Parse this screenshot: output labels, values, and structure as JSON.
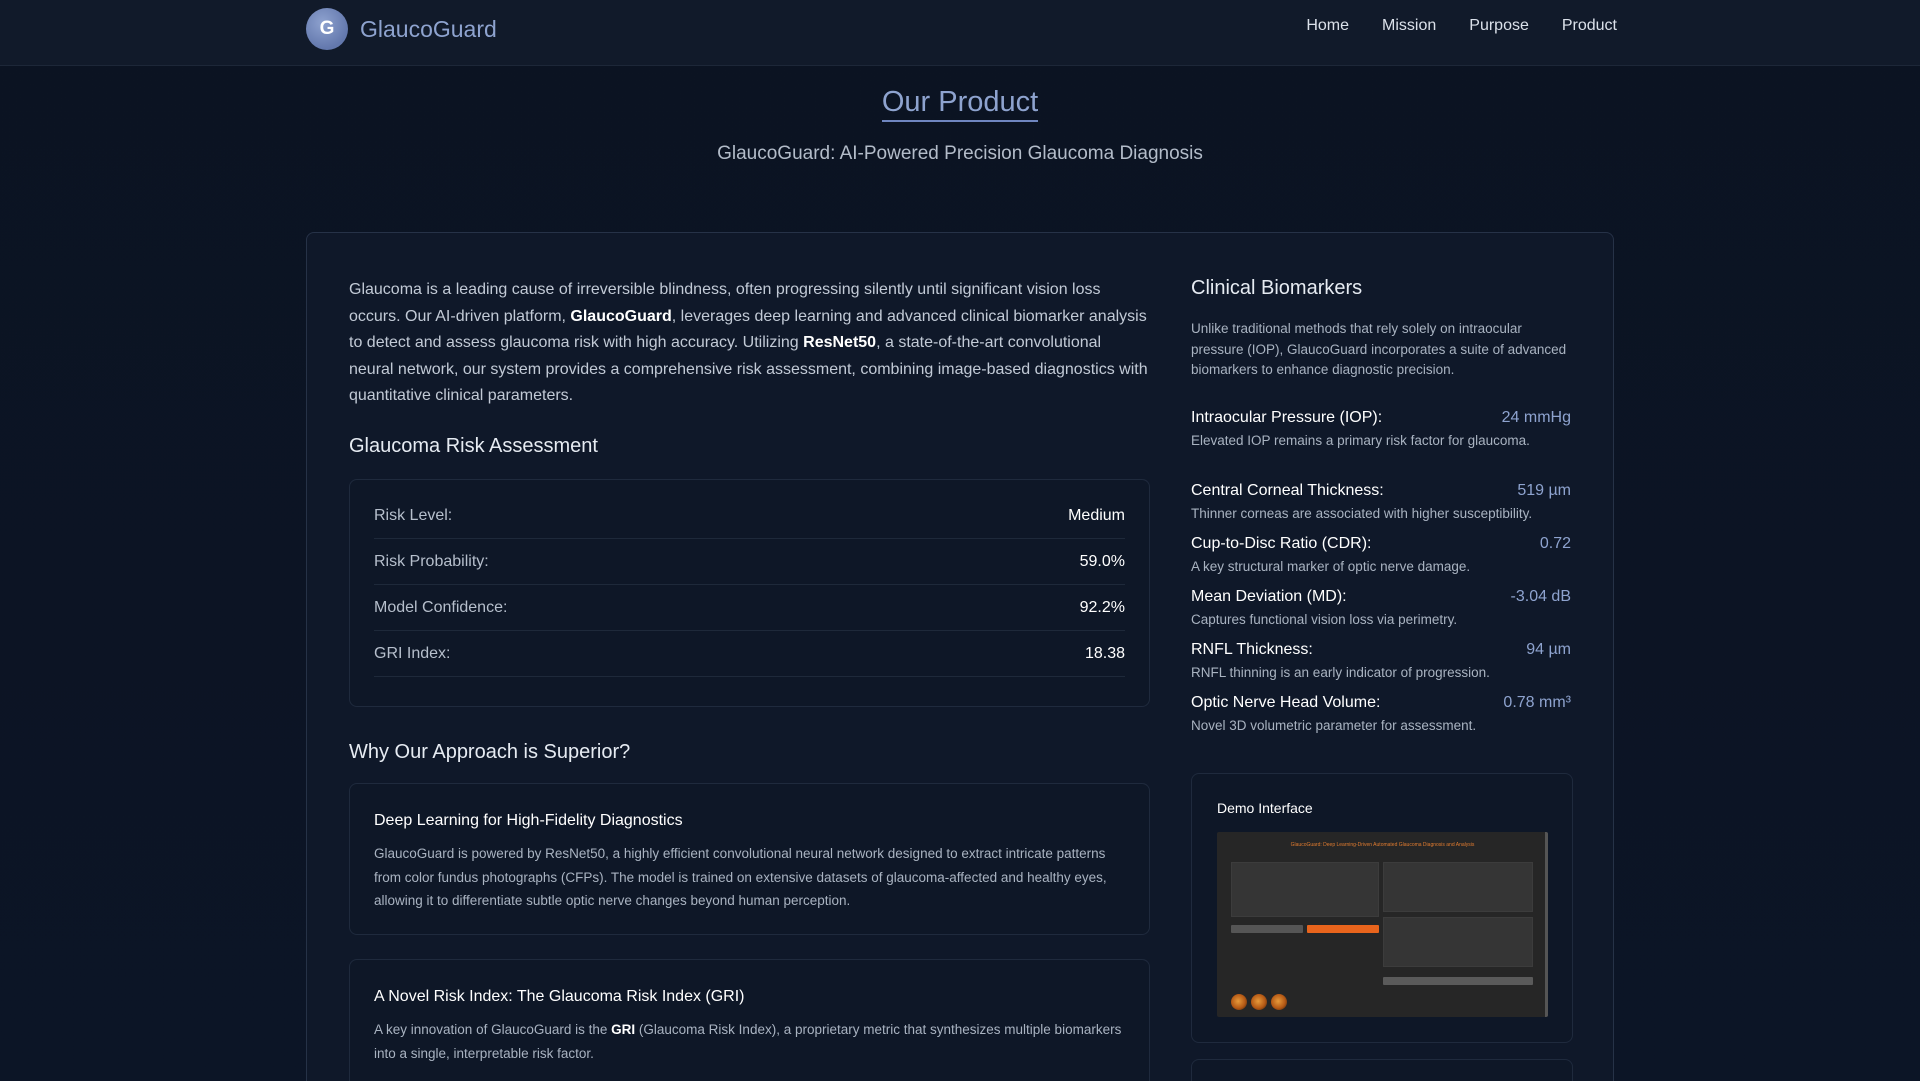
{
  "nav": {
    "logo_letter": "G",
    "brand": "GlaucoGuard",
    "links": [
      "Home",
      "Mission",
      "Purpose",
      "Product"
    ]
  },
  "hero": {
    "title": "Our Product",
    "subtitle": "GlaucoGuard: AI-Powered Precision Glaucoma Diagnosis"
  },
  "intro": {
    "part1": "Glaucoma is a leading cause of irreversible blindness, often progressing silently until significant vision loss occurs. Our AI-driven platform, ",
    "bold1": "GlaucoGuard",
    "part2": ", leverages deep learning and advanced clinical biomarker analysis to detect and assess glaucoma risk with high accuracy. Utilizing ",
    "bold2": "ResNet50",
    "part3": ", a state-of-the-art convolutional neural network, our system provides a comprehensive risk assessment, combining image-based diagnostics with quantitative clinical parameters."
  },
  "risk": {
    "heading": "Glaucoma Risk Assessment",
    "rows": [
      {
        "label": "Risk Level:",
        "value": "Medium"
      },
      {
        "label": "Risk Probability:",
        "value": "59.0%"
      },
      {
        "label": "Model Confidence:",
        "value": "92.2%"
      },
      {
        "label": "GRI Index:",
        "value": "18.38"
      }
    ]
  },
  "approach": {
    "heading": "Why Our Approach is Superior?",
    "features": [
      {
        "title": "Deep Learning for High-Fidelity Diagnostics",
        "text": "GlaucoGuard is powered by ResNet50, a highly efficient convolutional neural network designed to extract intricate patterns from color fundus photographs (CFPs). The model is trained on extensive datasets of glaucoma-affected and healthy eyes, allowing it to differentiate subtle optic nerve changes beyond human perception."
      },
      {
        "title": "A Novel Risk Index: The Glaucoma Risk Index (GRI)",
        "text_pre": "A key innovation of GlaucoGuard is the ",
        "text_bold": "GRI",
        "text_post": " (Glaucoma Risk Index), a proprietary metric that synthesizes multiple biomarkers into a single, interpretable risk factor."
      }
    ]
  },
  "biomarkers": {
    "title": "Clinical Biomarkers",
    "intro": "Unlike traditional methods that rely solely on intraocular pressure (IOP), GlaucoGuard incorporates a suite of advanced biomarkers to enhance diagnostic precision.",
    "items": [
      {
        "name": "Intraocular Pressure (IOP):",
        "value": "24 mmHg",
        "desc": "Elevated IOP remains a primary risk factor for glaucoma."
      },
      {
        "name": "Central Corneal Thickness:",
        "value": "519 µm",
        "desc": "Thinner corneas are associated with higher susceptibility."
      },
      {
        "name": "Cup-to-Disc Ratio (CDR):",
        "value": "0.72",
        "desc": "A key structural marker of optic nerve damage."
      },
      {
        "name": "Mean Deviation (MD):",
        "value": "-3.04 dB",
        "desc": "Captures functional vision loss via perimetry."
      },
      {
        "name": "RNFL Thickness:",
        "value": "94 µm",
        "desc": "RNFL thinning is an early indicator of progression."
      },
      {
        "name": "Optic Nerve Head Volume:",
        "value": "0.78 mm³",
        "desc": "Novel 3D volumetric parameter for assessment."
      }
    ]
  },
  "demo": {
    "title": "Demo Interface",
    "screenshot_header": "GlaucoGuard: Deep Learning-Driven Automated Glaucoma Diagnosis and Analysis"
  }
}
